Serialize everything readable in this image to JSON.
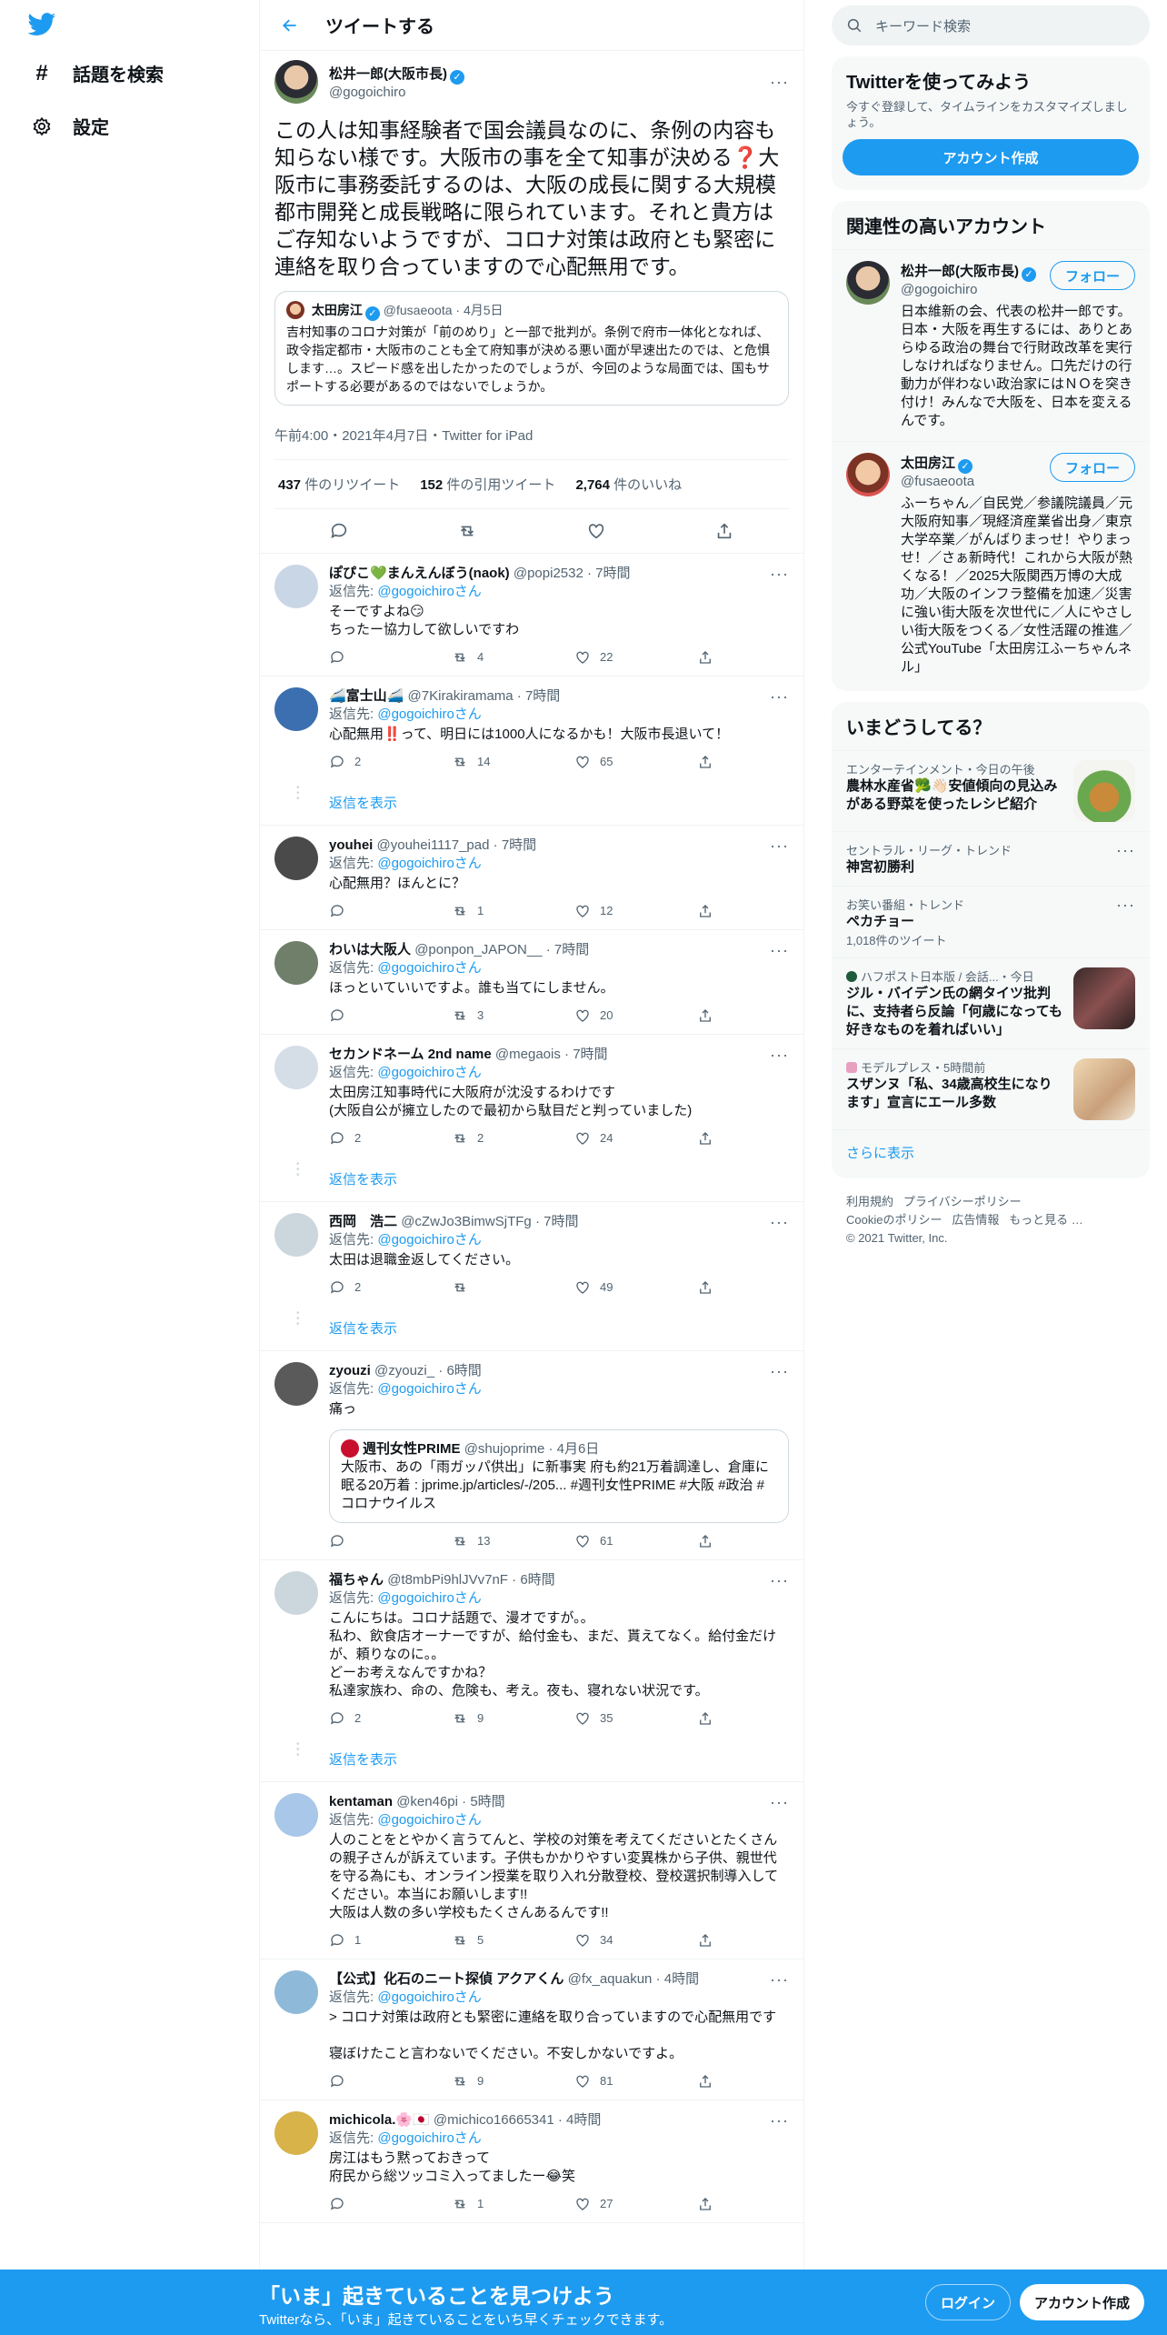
{
  "nav": {
    "explore": "話題を検索",
    "settings": "設定"
  },
  "header": {
    "title": "ツイートする"
  },
  "focus": {
    "name": "松井一郎(大阪市長)",
    "handle": "@gogoichiro",
    "text": "この人は知事経験者で国会議員なのに、条例の内容も知らない様です。大阪市の事を全て知事が決める❓大阪市に事務委託するのは、大阪の成長に関する大規模都市開発と成長戦略に限られています。それと貴方はご存知ないようですが、コロナ対策は政府とも緊密に連絡を取り合っていますので心配無用です。",
    "quote": {
      "name": "太田房江",
      "handle": "@fusaeoota",
      "date": "4月5日",
      "text": "吉村知事のコロナ対策が「前のめり」と一部で批判が。条例で府市一体化となれば、政令指定都市・大阪市のことも全て府知事が決める悪い面が早速出たのでは、と危惧します…。スピード感を出したかったのでしょうが、今回のような局面では、国もサポートする必要があるのではないでしょうか。"
    },
    "meta": "午前4:00・2021年4月7日・Twitter for iPad",
    "retweets": "437",
    "retweets_label": "件のリツイート",
    "quotes": "152",
    "quotes_label": "件の引用ツイート",
    "likes": "2,764",
    "likes_label": "件のいいね"
  },
  "reply_to_prefix": "返信先:",
  "reply_to_handle": "@gogoichiroさん",
  "show_replies": "返信を表示",
  "replies": [
    {
      "name": "ぽぴこ💚まんえんぼう(naok)",
      "handle": "@popi2532",
      "time": "7時間",
      "text": "そーですよね😏\nちったー協力して欲しいですわ",
      "reply": "",
      "rt": "4",
      "like": "22",
      "avatar": "#c9d6e6"
    },
    {
      "name": "🚄富士山🚄",
      "handle": "@7Kirakiramama",
      "time": "7時間",
      "text": "心配無用‼️って、明日には1000人になるかも！大阪市長退いて！",
      "reply": "2",
      "rt": "14",
      "like": "65",
      "avatar": "#3b6fb0"
    },
    {
      "name": "youhei",
      "handle": "@youhei1117_pad",
      "time": "7時間",
      "text": "心配無用？ほんとに？",
      "reply": "",
      "rt": "1",
      "like": "12",
      "avatar": "#4a4a4a"
    },
    {
      "name": "わいは大阪人",
      "handle": "@ponpon_JAPON__",
      "time": "7時間",
      "text": "ほっといていいですよ。誰も当てにしません。",
      "reply": "",
      "rt": "3",
      "like": "20",
      "avatar": "#6f7f6a"
    },
    {
      "name": "セカンドネーム 2nd name",
      "handle": "@megaois",
      "time": "7時間",
      "text": "太田房江知事時代に大阪府が沈没するわけです\n(大阪自公が擁立したので最初から駄目だと判っていました)",
      "reply": "2",
      "rt": "2",
      "like": "24",
      "avatar": "#d5dde6"
    },
    {
      "name": "西岡　浩二",
      "handle": "@cZwJo3BimwSjTFg",
      "time": "7時間",
      "text": "太田は退職金返してください。",
      "reply": "2",
      "rt": "",
      "like": "49",
      "avatar": "#ccd6dd"
    },
    {
      "name": "zyouzi",
      "handle": "@zyouzi_",
      "time": "6時間",
      "text": "痛っ",
      "reply": "",
      "rt": "13",
      "like": "61",
      "avatar": "#5a5a5a",
      "quote": {
        "name": "週刊女性PRIME",
        "handle": "@shujoprime",
        "date": "4月6日",
        "text": "大阪市、あの「雨ガッパ供出」に新事実 府も約21万着調達し、倉庫に眠る20万着 : jprime.jp/articles/-/205... #週刊女性PRIME #大阪 #政治 #コロナウイルス"
      }
    },
    {
      "name": "福ちゃん",
      "handle": "@t8mbPi9hlJVv7nF",
      "time": "6時間",
      "text": "こんにちは。コロナ話題で、漫オですが。。\n私わ、飲食店オーナーですが、給付金も、まだ、貰えてなく。給付金だけが、頼りなのに。。\nどーお考えなんですかね？\n私達家族わ、命の、危険も、考え。夜も、寝れない状況です。",
      "reply": "2",
      "rt": "9",
      "like": "35",
      "avatar": "#ccd6dd"
    },
    {
      "name": "kentaman",
      "handle": "@ken46pi",
      "time": "5時間",
      "text": "人のことをとやかく言うてんと、学校の対策を考えてくださいとたくさんの親子さんが訴えています。子供もかかりやすい変異株から子供、親世代を守る為にも、オンライン授業を取り入れ分散登校、登校選択制導入してください。本当にお願いします!!\n大阪は人数の多い学校もたくさんあるんです!!",
      "reply": "1",
      "rt": "5",
      "like": "34",
      "avatar": "#a9c7e8"
    },
    {
      "name": "【公式】化石のニート探偵 アクアくん",
      "handle": "@fx_aquakun",
      "time": "4時間",
      "text": "> コロナ対策は政府とも緊密に連絡を取り合っていますので心配無用です\n\n寝ぼけたこと言わないでください。不安しかないですよ。",
      "reply": "",
      "rt": "9",
      "like": "81",
      "avatar": "#8fb9d9"
    },
    {
      "name": "michicola.🌸🇯🇵",
      "handle": "@michico16665341",
      "time": "4時間",
      "text": "房江はもう黙っておきって\n府民から総ツッコミ入ってましたー😂笑",
      "reply": "",
      "rt": "1",
      "like": "27",
      "avatar": "#d8b34a"
    }
  ],
  "search": {
    "placeholder": "キーワード検索"
  },
  "signup_card": {
    "title": "Twitterを使ってみよう",
    "sub": "今すぐ登録して、タイムラインをカスタマイズしましょう。",
    "button": "アカウント作成"
  },
  "related": {
    "title": "関連性の高いアカウント",
    "follow": "フォロー",
    "accounts": [
      {
        "name": "松井一郎(大阪市長)",
        "handle": "@gogoichiro",
        "bio": "日本維新の会、代表の松井一郎です。日本・大阪を再生するには、ありとあらゆる政治の舞台で行財政改革を実行しなければなりません。口先だけの行動力が伴わない政治家にはＮＯを突き付け！みんなで大阪を、日本を変えるんです。"
      },
      {
        "name": "太田房江",
        "handle": "@fusaeoota",
        "bio": "ふーちゃん／自民党／参議院議員／元大阪府知事／現経済産業省出身／東京大学卒業／がんばりまっせ！やりまっせ！／さぁ新時代！これから大阪が熱くなる！／2025大阪関西万博の大成功／大阪のインフラ整備を加速／災害に強い街大阪を次世代に／人にやさしい街大阪をつくる／女性活躍の推進／公式YouTube「太田房江ふーちゃんネル」"
      }
    ]
  },
  "trends": {
    "title": "いまどうしてる？",
    "items": [
      {
        "ctx": "エンターテインメント・今日の午後",
        "title": "農林水産省🥦👋🏻安値傾向の見込みがある野菜を使ったレシピ紹介",
        "count": ""
      },
      {
        "ctx": "セントラル・リーグ・トレンド",
        "title": "神宮初勝利",
        "count": ""
      },
      {
        "ctx": "お笑い番組・トレンド",
        "title": "ペカチョー",
        "count": "1,018件のツイート"
      },
      {
        "ctx": "ハフポスト日本版 / 会話...・今日",
        "title": "ジル・バイデン氏の網タイツ批判に、支持者ら反論「何歳になっても好きなものを着ればいい」",
        "count": ""
      },
      {
        "ctx": "モデルプレス・5時間前",
        "title": "スザンヌ「私、34歳高校生になります」宣言にエール多数",
        "count": ""
      }
    ],
    "show_more": "さらに表示"
  },
  "footer": {
    "terms": "利用規約",
    "privacy": "プライバシーポリシー",
    "cookie": "Cookieのポリシー",
    "ads": "広告情報",
    "more": "もっと見る …",
    "copy": "© 2021 Twitter, Inc."
  },
  "bottom": {
    "title": "「いま」起きていることを見つけよう",
    "sub": "Twitterなら、「いま」起きていることをいち早くチェックできます。",
    "login": "ログイン",
    "signup": "アカウント作成"
  },
  "colors": {
    "accent": "#1d9bf0",
    "muted": "#536471",
    "border": "#eff3f4"
  }
}
